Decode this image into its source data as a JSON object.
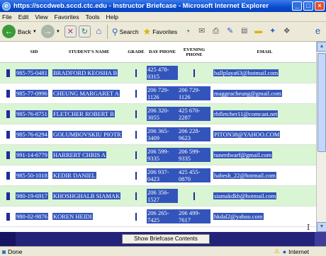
{
  "window": {
    "title": "https://sccdweb.sccd.ctc.edu - Instructor Briefcase - Microsoft Internet Explorer"
  },
  "menu": [
    "File",
    "Edit",
    "View",
    "Favorites",
    "Tools",
    "Help"
  ],
  "toolbar": {
    "back_label": "Back",
    "search_label": "Search",
    "favorites_label": "Favorites"
  },
  "table": {
    "headers": {
      "sid": "SID",
      "name": "STUDENT'S NAME",
      "grade": "GRADE",
      "day_phone": "DAY PHONE",
      "evening_phone": "EVENING PHONE",
      "email": "EMAIL"
    },
    "rows": [
      {
        "sid": "985-75-0481",
        "name": "BRADFORD KEOSHA B",
        "day": "425 478-0315",
        "eve": "",
        "email": "ballplaya63@hotmail.com"
      },
      {
        "sid": "985-77-0996",
        "name": "CHEUNG MARGARET A",
        "day": "206 729-1126",
        "eve": "206 729-1126",
        "email": "maggeacheung@gmail.com"
      },
      {
        "sid": "985-76-8751",
        "name": "FLETCHER ROBERT B",
        "day": "206 320-3055",
        "eve": "425 670-2287",
        "email": "rbfletcher11@comcast.net"
      },
      {
        "sid": "985-76-6294",
        "name": "GOLUMBOVSKIU PIOTR",
        "day": "206 365-3409",
        "eve": "206 228-9623",
        "email": "PITON38@YAHOO.COM"
      },
      {
        "sid": "991-14-6779",
        "name": "HARRERT CHRIS A",
        "day": "206 599-9335",
        "eve": "206 599-9335",
        "email": "tunerdwarf@gmail.com"
      },
      {
        "sid": "985-50-1018",
        "name": "KEDIR DANIEL",
        "day": "206 937-0423",
        "eve": "425 455-0870",
        "email": "habesh_22@hotmail.com"
      },
      {
        "sid": "980-19-6917",
        "name": "KHOSHGHALB SIAMAK",
        "day": "206 356-1527",
        "eve": "",
        "email": "siamakdkh@hotmail.com"
      },
      {
        "sid": "980-02-9876",
        "name": "KOREN HEIDI",
        "day": "206 265-7425",
        "eve": "206 499-7617",
        "email": "hkdal2@yahoo.com"
      }
    ]
  },
  "briefcase": {
    "show_button": "Show Briefcase Contents"
  },
  "status": {
    "text": "Done",
    "zone": "Internet"
  }
}
